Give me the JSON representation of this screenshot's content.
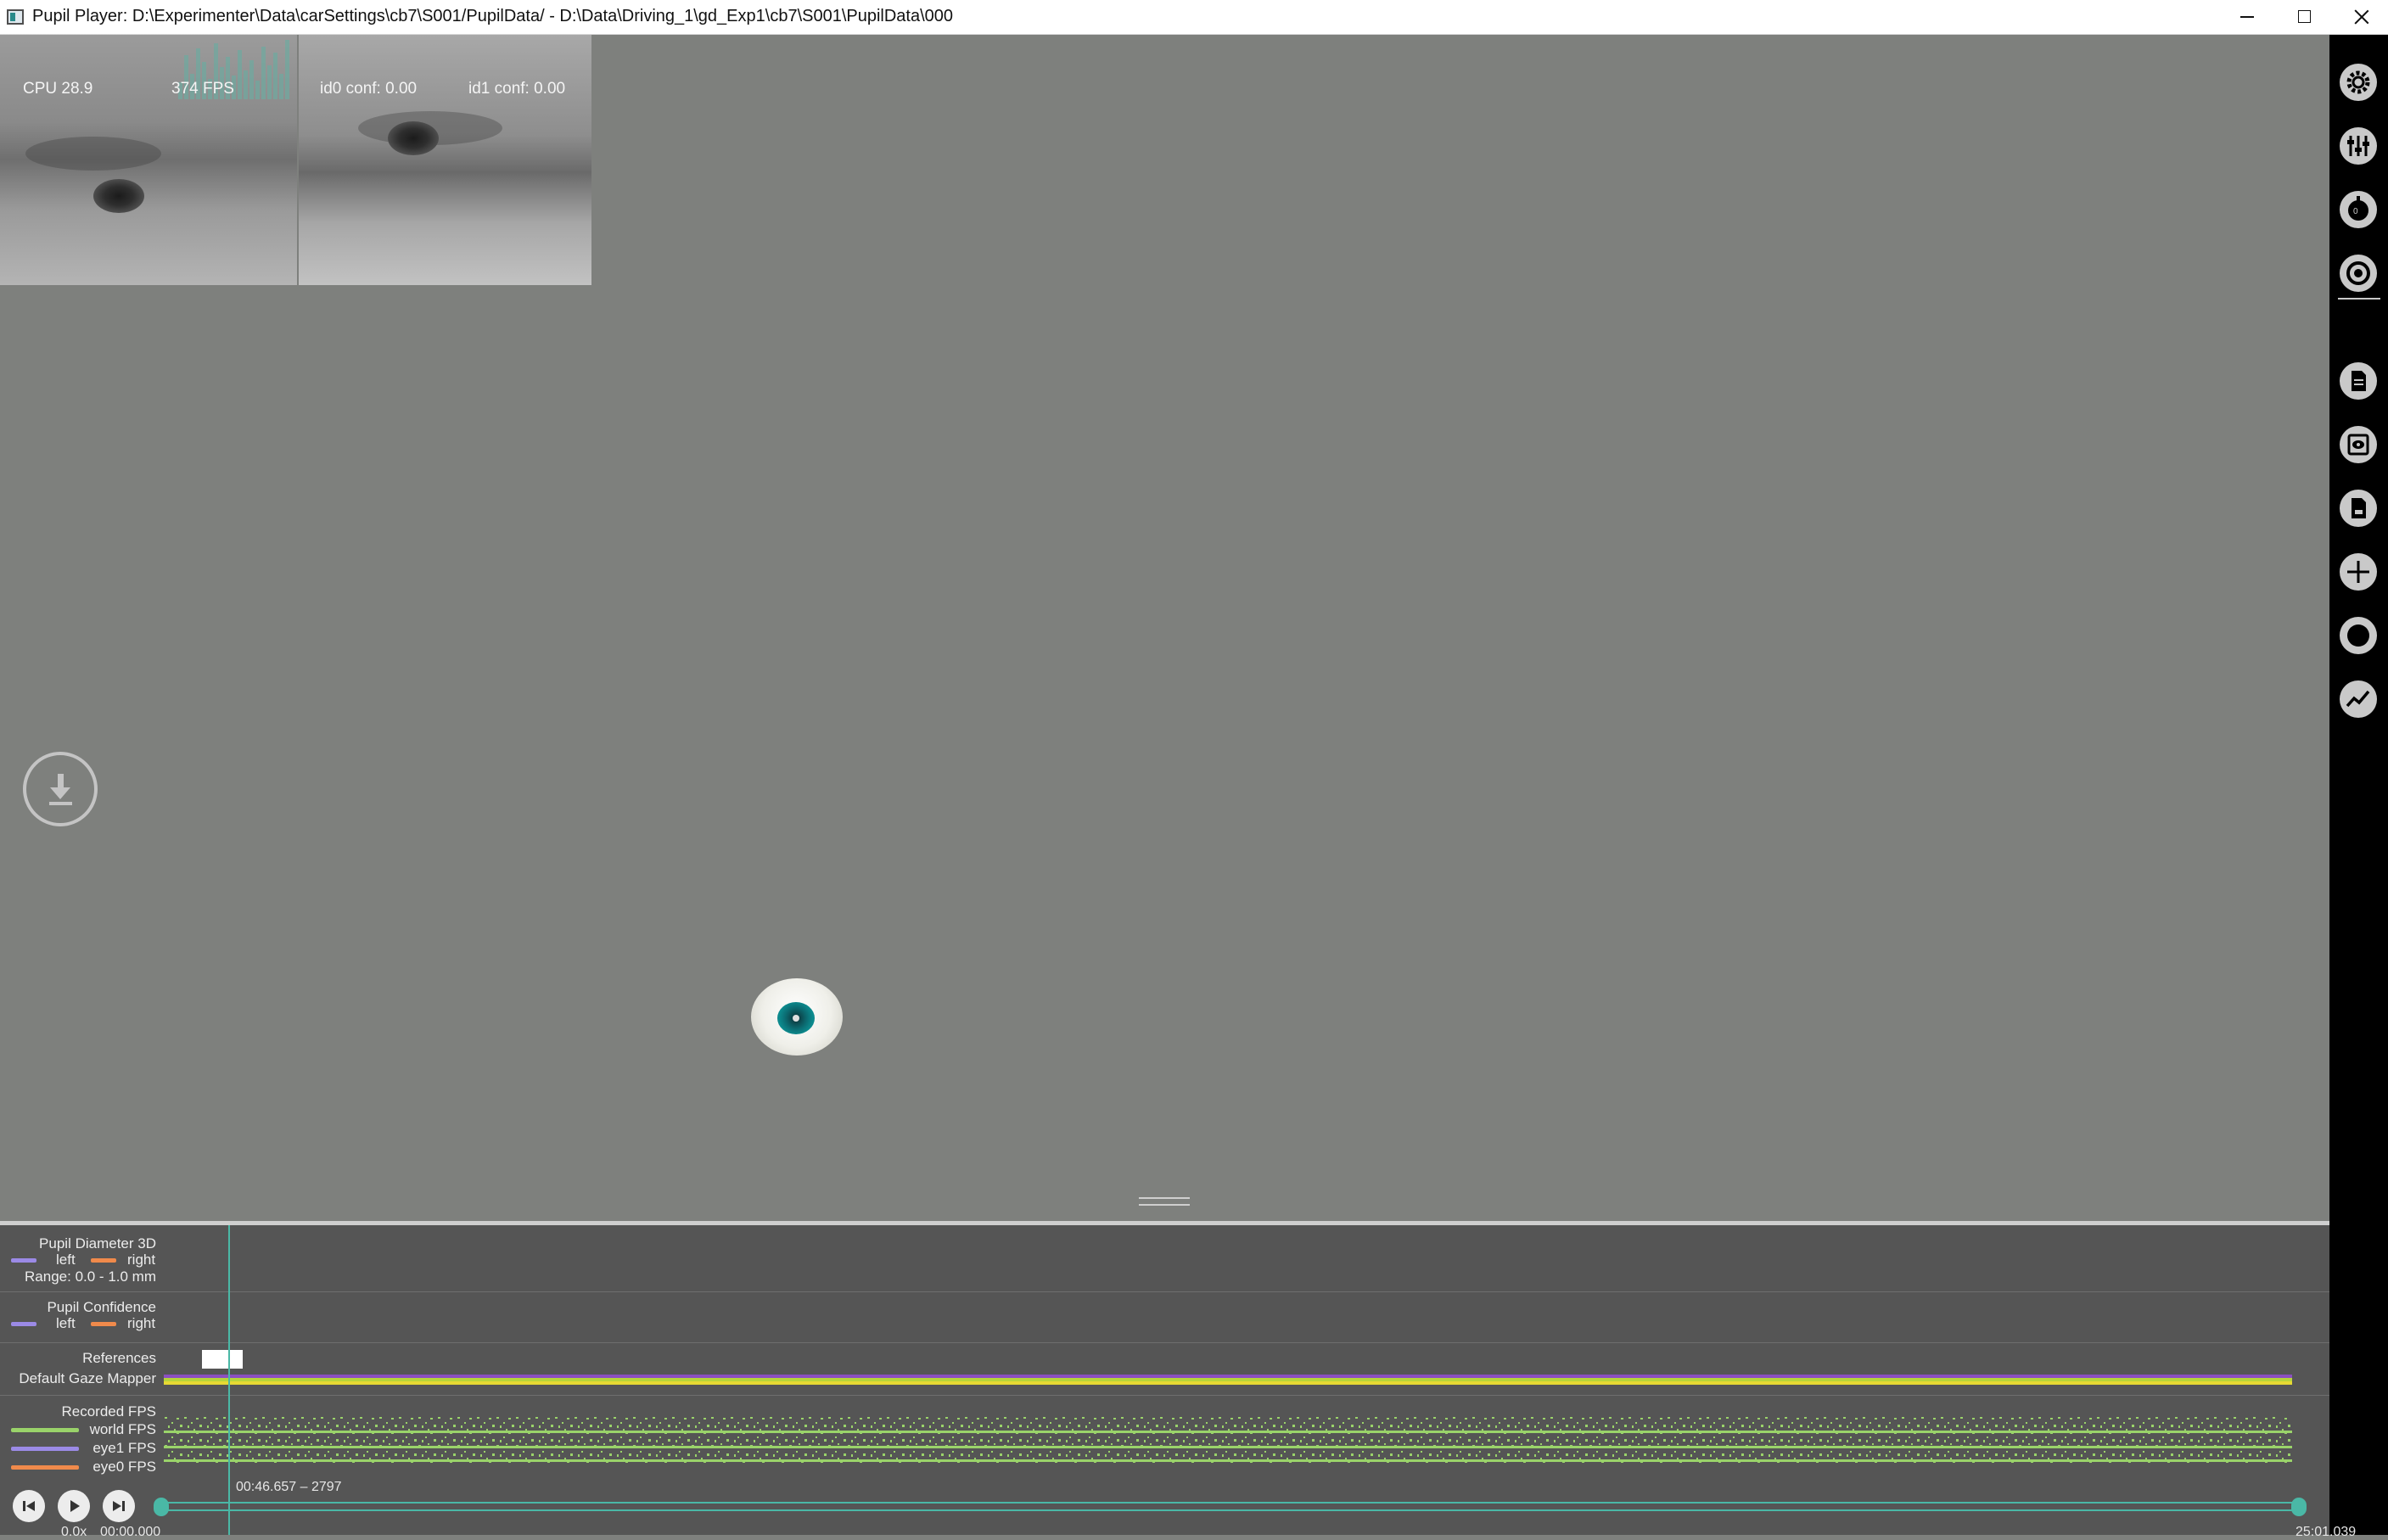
{
  "window": {
    "title": "Pupil Player: D:\\Experimenter\\Data\\carSettings\\cb7\\S001/PupilData/ - D:\\Data\\Driving_1\\gd_Exp1\\cb7\\S001\\PupilData\\000",
    "icons": [
      "minimize-icon",
      "maximize-icon",
      "close-icon"
    ]
  },
  "overlay": {
    "cpu": "CPU 28.9",
    "fps": "374 FPS",
    "id0_conf": "id0 conf: 0.00",
    "id1_conf": "id1 conf: 0.00"
  },
  "right_menu": {
    "icons": [
      "settings-icon",
      "plugin-manager-icon",
      "eye0-icon",
      "eye1-icon",
      "annotation-icon",
      "eye-overlay-icon",
      "raw-data-export-icon",
      "gaze-crosshair-icon",
      "fixation-circle-icon",
      "timeline-graph-icon"
    ]
  },
  "timeline": {
    "rows": {
      "pupil_diameter": {
        "title": "Pupil Diameter 3D",
        "left": "left",
        "right": "right",
        "range": "Range: 0.0 - 1.0 mm"
      },
      "pupil_confidence": {
        "title": "Pupil Confidence",
        "left": "left",
        "right": "right"
      },
      "references": {
        "title": "References"
      },
      "gaze_mapper": {
        "title": "Default Gaze Mapper"
      },
      "recorded_fps": {
        "title": "Recorded FPS",
        "world": "world FPS",
        "eye1": "eye1 FPS",
        "eye0": "eye0 FPS"
      }
    },
    "colors": {
      "left": "#9b8ae6",
      "right": "#f08a4b",
      "fps_points": "#9ad36a",
      "accent": "#4ab8a6"
    },
    "playback": {
      "current_time": "00:46.657 – 2797",
      "speed": "0.0x",
      "start_time": "00:00.000",
      "end_time": "25:01.039",
      "buttons": [
        "skip-back-icon",
        "play-icon",
        "skip-forward-icon"
      ]
    }
  }
}
